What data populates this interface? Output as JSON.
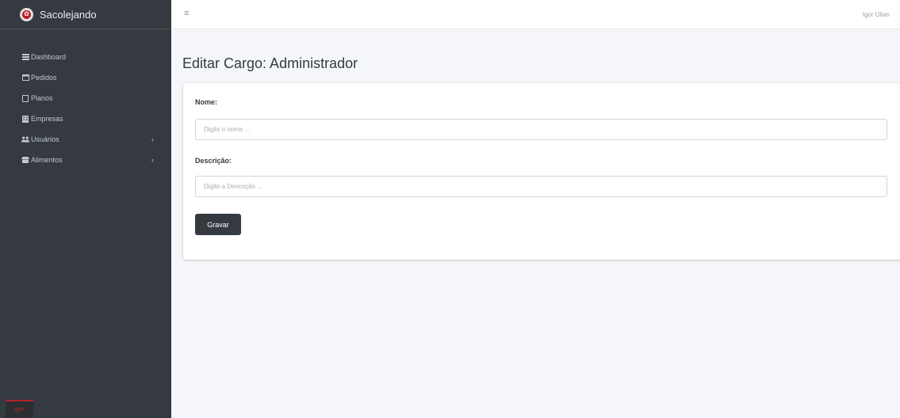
{
  "brand": {
    "name": "Sacolejando"
  },
  "sidebar": {
    "items": [
      {
        "label": "Dashboard",
        "icon": "dashboard-icon"
      },
      {
        "label": "Pedidos",
        "icon": "window-icon"
      },
      {
        "label": "Planos",
        "icon": "file-icon"
      },
      {
        "label": "Empresas",
        "icon": "building-icon"
      },
      {
        "label": "Usuários",
        "icon": "users-icon"
      },
      {
        "label": "Alimentos",
        "icon": "store-icon"
      }
    ],
    "footer_label": "Igor"
  },
  "topbar": {
    "user_name": "Igor Ulian"
  },
  "page": {
    "title": "Editar Cargo: Administrador"
  },
  "form": {
    "nome_label": "Nome:",
    "nome_placeholder": "Digite o nome ...",
    "nome_value": "",
    "descricao_label": "Descrição:",
    "descricao_placeholder": "Digite a Descrição ...",
    "descricao_value": "",
    "submit_label": "Gravar"
  },
  "colors": {
    "sidebar_bg": "#343a40",
    "brand_accent": "#b8212c",
    "content_bg": "#f4f6f9",
    "button_bg": "#343a40"
  }
}
